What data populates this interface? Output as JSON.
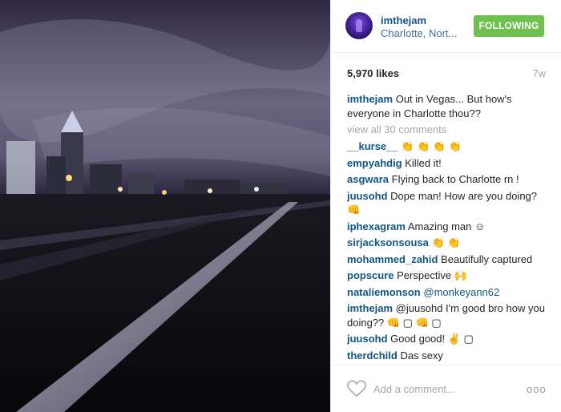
{
  "header": {
    "username": "imthejam",
    "location": "Charlotte, Nort...",
    "follow_label": "FOLLOWING"
  },
  "meta": {
    "likes": "5,970 likes",
    "age": "7w"
  },
  "caption": {
    "user": "imthejam",
    "text": "Out in Vegas... But how's everyone in Charlotte thou??"
  },
  "view_all": "view all 30 comments",
  "comments": [
    {
      "user": "__kurse__",
      "text": "👏 👏 👏 👏"
    },
    {
      "user": "empyahdig",
      "text": "Killed it!"
    },
    {
      "user": "asgwara",
      "text": "Flying back to Charlotte rn !"
    },
    {
      "user": "juusohd",
      "text": "Dope man! How are you doing? 👊"
    },
    {
      "user": "iphexagram",
      "text": "Amazing man ☺"
    },
    {
      "user": "sirjacksonsousa",
      "text": "👏 👏"
    },
    {
      "user": "mohammed_zahid",
      "text": "Beautifully captured"
    },
    {
      "user": "popscure",
      "text": "Perspective 🙌"
    },
    {
      "user": "nataliemonson",
      "text": "@monkeyann62"
    },
    {
      "user": "imthejam",
      "text": "@juusohd I'm good bro how you doing?? 👊 ▢ 👊 ▢"
    },
    {
      "user": "juusohd",
      "text": "Good good! ✌ ▢"
    },
    {
      "user": "therdchild",
      "text": "Das sexy"
    }
  ],
  "footer": {
    "add_comment_placeholder": "Add a comment...",
    "more_label": "ooo"
  },
  "icons": {
    "heart": "heart-icon",
    "more": "more-options-icon"
  },
  "colors": {
    "link": "#125688",
    "follow": "#70c050",
    "muted": "#a5a7aa"
  }
}
